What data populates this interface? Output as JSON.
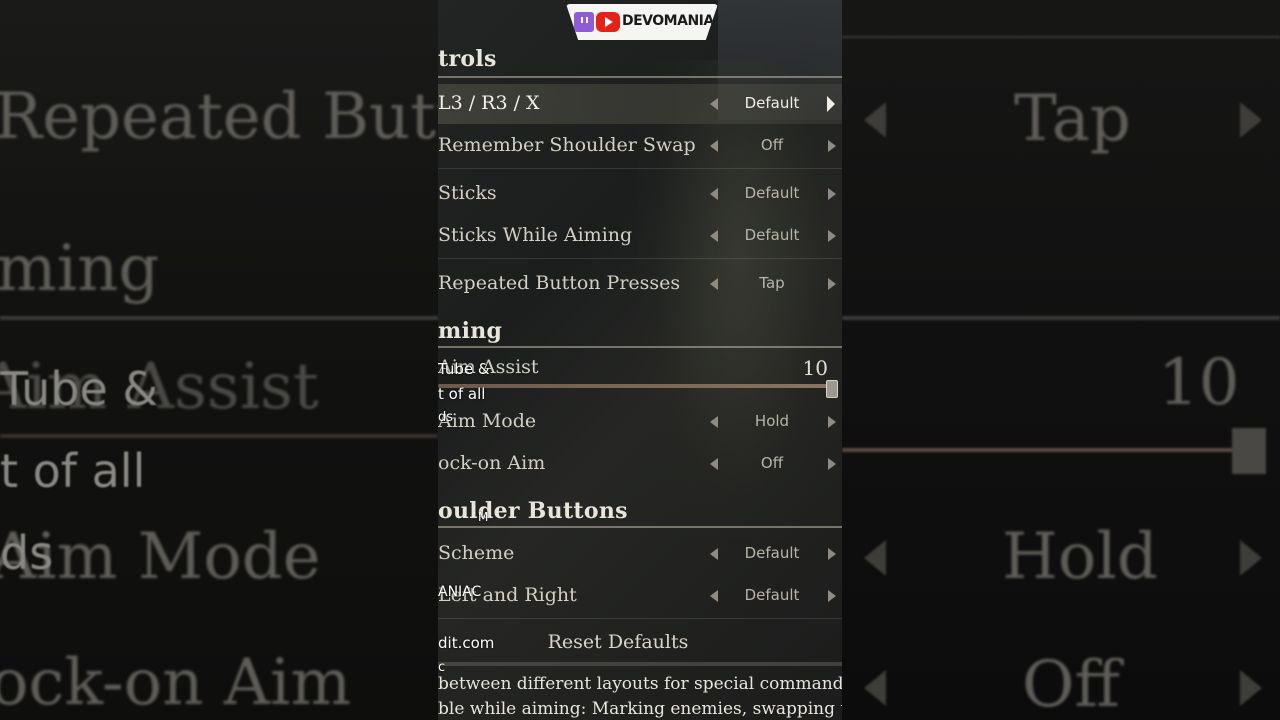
{
  "branding": {
    "logo_text": "DEVOMANIAC",
    "twitch_icon": "twitch-icon",
    "youtube_icon": "youtube-icon"
  },
  "background": {
    "left_texts": [
      "Repeated Butto",
      "ming",
      "Aim Assist",
      "Aim Mode",
      "ock-on Aim"
    ],
    "left_overlay": [
      "Tube &",
      "t of all",
      "ds"
    ],
    "right_texts": [
      "Tap",
      "10",
      "Hold",
      "Off"
    ]
  },
  "settings": {
    "sections": [
      {
        "title": "trols"
      },
      {
        "title": "ming"
      },
      {
        "title": "oulder Buttons"
      }
    ],
    "rows": [
      {
        "label": "L3 / R3 / X",
        "value": "Default"
      },
      {
        "label": "Remember Shoulder Swap",
        "value": "Off"
      },
      {
        "label": "Sticks",
        "value": "Default"
      },
      {
        "label": "Sticks While Aiming",
        "value": "Default"
      },
      {
        "label": "Repeated Button Presses",
        "value": "Tap"
      },
      {
        "label": "Aim Assist",
        "value": "10"
      },
      {
        "label": "Aim Mode",
        "value": "Hold"
      },
      {
        "label": "ock-on Aim",
        "value": "Off"
      },
      {
        "label": "Scheme",
        "value": "Default"
      },
      {
        "label": "Left and Right",
        "value": "Default"
      }
    ],
    "aim_assist_level": 1.0,
    "reset_label": "Reset Defaults",
    "description": [
      "between different layouts for special commands",
      "ble while aiming: Marking enemies, swapping the"
    ]
  },
  "overlay_text": [
    "Tube &",
    "t of all",
    "ds",
    "M",
    "ANIAC",
    "dit.com",
    "c"
  ]
}
